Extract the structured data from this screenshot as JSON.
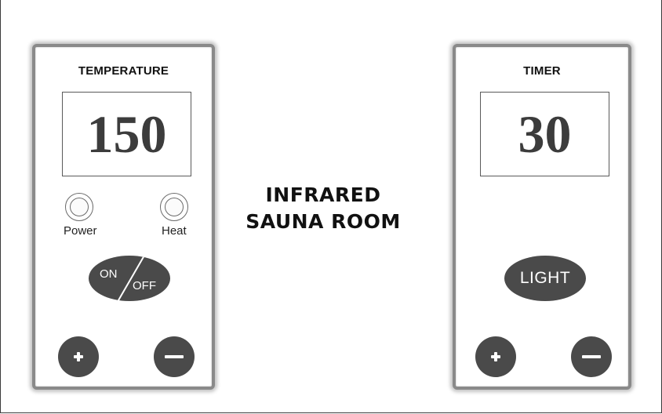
{
  "temperature_panel": {
    "title": "TEMPERATURE",
    "display_value": "150",
    "indicators": {
      "power_label": "Power",
      "heat_label": "Heat"
    },
    "onoff_button": {
      "on_label": "ON",
      "off_label": "OFF"
    },
    "increase_icon": "plus-icon",
    "decrease_icon": "minus-icon"
  },
  "center": {
    "title_line1": "INFRARED",
    "title_line2": "SAUNA ROOM"
  },
  "timer_panel": {
    "title": "TIMER",
    "display_value": "30",
    "light_button_label": "LIGHT",
    "increase_icon": "plus-icon",
    "decrease_icon": "minus-icon"
  },
  "colors": {
    "button_fill": "#4a4a4a",
    "panel_border": "#8a8a8a",
    "display_text": "#3c3c3c"
  }
}
